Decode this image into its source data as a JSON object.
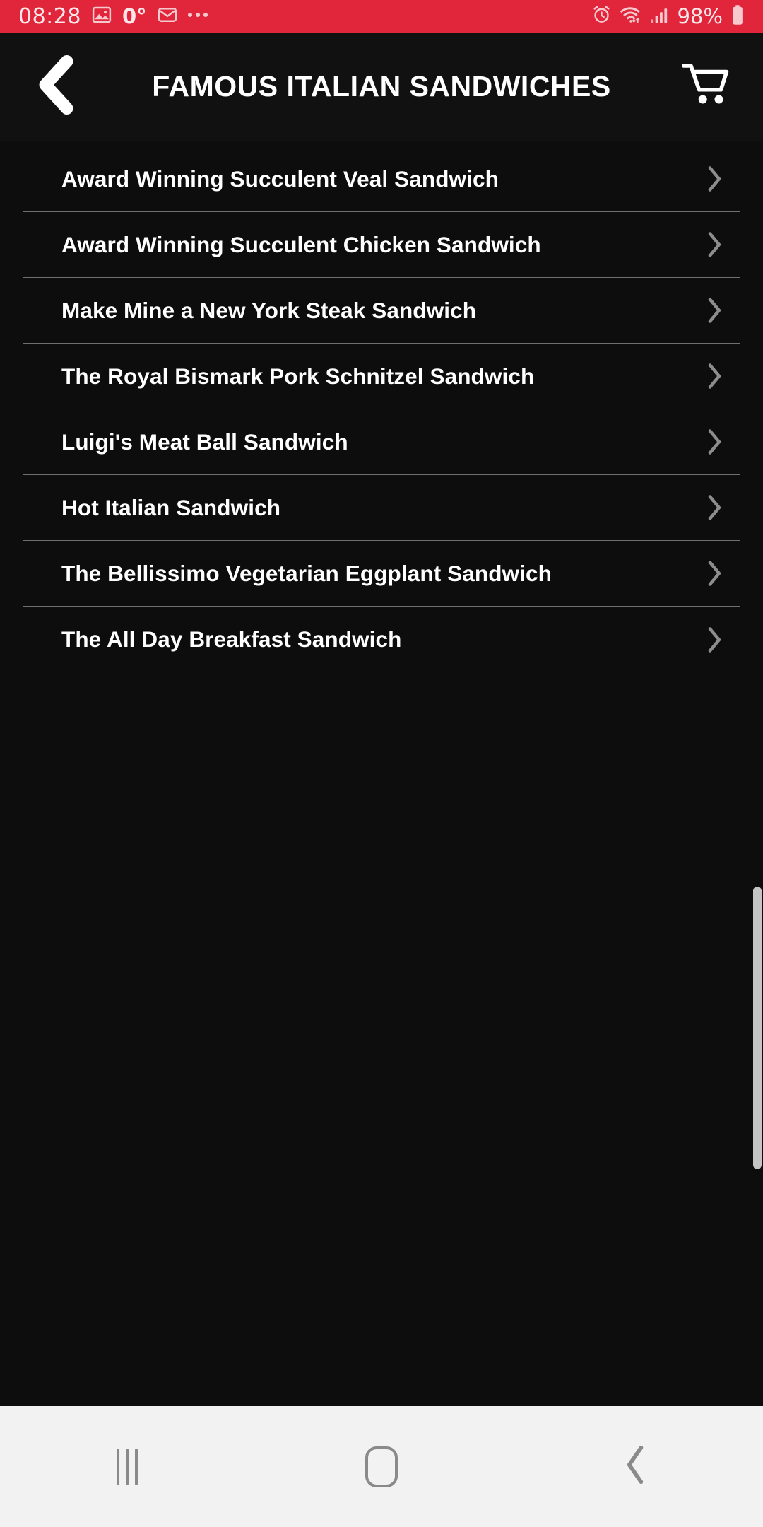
{
  "status_bar": {
    "time": "08:28",
    "temperature": "0°",
    "battery_percent": "98%",
    "icons": [
      "photo-icon",
      "mail-icon",
      "more-dots-icon",
      "alarm-icon",
      "wifi-icon",
      "signal-icon",
      "battery-icon"
    ],
    "background_color": "#e1253a",
    "text_color": "#fbe7e9"
  },
  "header": {
    "title": "FAMOUS ITALIAN SANDWICHES",
    "back_icon": "chevron-left-icon",
    "cart_icon": "shopping-cart-icon",
    "background_color": "#111111",
    "title_color": "#ffffff"
  },
  "list": {
    "chevron_icon": "chevron-right-icon",
    "divider_color": "#6f6f6f",
    "items": [
      {
        "label": "Award Winning Succulent Veal Sandwich"
      },
      {
        "label": "Award Winning Succulent Chicken Sandwich"
      },
      {
        "label": "Make Mine a New York Steak Sandwich"
      },
      {
        "label": "The Royal Bismark Pork Schnitzel Sandwich"
      },
      {
        "label": "Luigi's Meat Ball Sandwich"
      },
      {
        "label": "Hot Italian Sandwich"
      },
      {
        "label": "The Bellissimo Vegetarian Eggplant Sandwich"
      },
      {
        "label": "The All Day Breakfast Sandwich"
      }
    ]
  },
  "scrollbar": {
    "thumb_color": "#c4c4c4"
  },
  "nav_bar": {
    "recents_icon": "recents-icon",
    "home_icon": "home-icon",
    "back_icon": "back-chevron-icon",
    "background_color": "#f2f2f2",
    "icon_color": "#8a8a8a"
  }
}
